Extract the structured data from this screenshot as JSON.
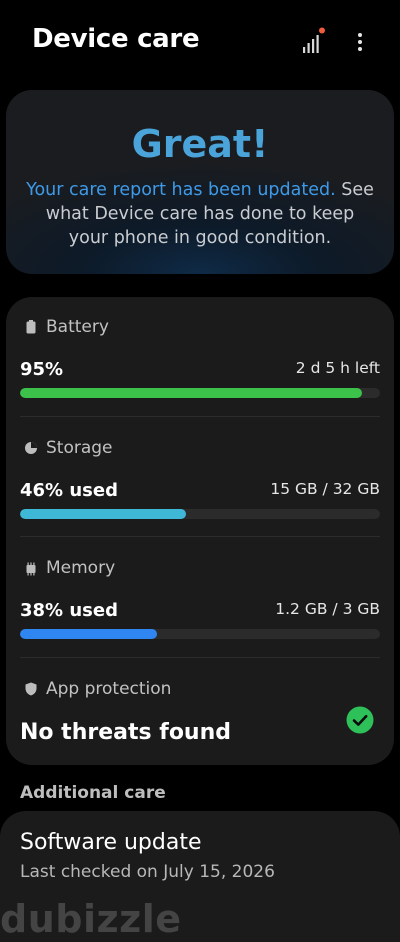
{
  "header": {
    "title": "Device care"
  },
  "hero": {
    "title": "Great!",
    "message_link": "Your care report has been updated.",
    "message_rest": " See what Device care has done to keep your phone in good condition."
  },
  "battery": {
    "label": "Battery",
    "value": "95%",
    "detail": "2 d 5 h left",
    "percent": 95,
    "color": "#3cc24a"
  },
  "storage": {
    "label": "Storage",
    "value": "46% used",
    "detail": "15 GB / 32 GB",
    "percent": 46,
    "color": "#3fb8d8"
  },
  "memory": {
    "label": "Memory",
    "value": "38% used",
    "detail": "1.2 GB / 3 GB",
    "percent": 38,
    "color": "#2f86f0"
  },
  "protection": {
    "label": "App protection",
    "status": "No threats found",
    "status_color": "#2ec15a"
  },
  "additional": {
    "label": "Additional care"
  },
  "software_update": {
    "title": "Software update",
    "subtitle": "Last checked on July 15, 2026"
  },
  "watermark": {
    "text": "dubizzle"
  },
  "icons": {
    "signal": "signal-bars-icon",
    "more": "more-vertical-icon",
    "battery": "battery-icon",
    "storage": "pie-chart-icon",
    "memory": "chip-icon",
    "protection": "shield-icon",
    "check": "check-circle-icon"
  }
}
